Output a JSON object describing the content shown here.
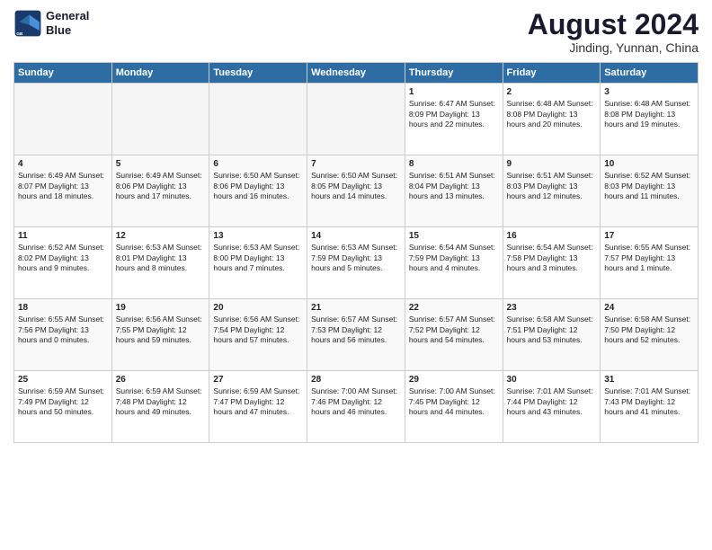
{
  "logo": {
    "line1": "General",
    "line2": "Blue"
  },
  "title": "August 2024",
  "subtitle": "Jinding, Yunnan, China",
  "days_of_week": [
    "Sunday",
    "Monday",
    "Tuesday",
    "Wednesday",
    "Thursday",
    "Friday",
    "Saturday"
  ],
  "weeks": [
    [
      {
        "day": "",
        "info": ""
      },
      {
        "day": "",
        "info": ""
      },
      {
        "day": "",
        "info": ""
      },
      {
        "day": "",
        "info": ""
      },
      {
        "day": "1",
        "info": "Sunrise: 6:47 AM\nSunset: 8:09 PM\nDaylight: 13 hours and 22 minutes."
      },
      {
        "day": "2",
        "info": "Sunrise: 6:48 AM\nSunset: 8:08 PM\nDaylight: 13 hours and 20 minutes."
      },
      {
        "day": "3",
        "info": "Sunrise: 6:48 AM\nSunset: 8:08 PM\nDaylight: 13 hours and 19 minutes."
      }
    ],
    [
      {
        "day": "4",
        "info": "Sunrise: 6:49 AM\nSunset: 8:07 PM\nDaylight: 13 hours and 18 minutes."
      },
      {
        "day": "5",
        "info": "Sunrise: 6:49 AM\nSunset: 8:06 PM\nDaylight: 13 hours and 17 minutes."
      },
      {
        "day": "6",
        "info": "Sunrise: 6:50 AM\nSunset: 8:06 PM\nDaylight: 13 hours and 16 minutes."
      },
      {
        "day": "7",
        "info": "Sunrise: 6:50 AM\nSunset: 8:05 PM\nDaylight: 13 hours and 14 minutes."
      },
      {
        "day": "8",
        "info": "Sunrise: 6:51 AM\nSunset: 8:04 PM\nDaylight: 13 hours and 13 minutes."
      },
      {
        "day": "9",
        "info": "Sunrise: 6:51 AM\nSunset: 8:03 PM\nDaylight: 13 hours and 12 minutes."
      },
      {
        "day": "10",
        "info": "Sunrise: 6:52 AM\nSunset: 8:03 PM\nDaylight: 13 hours and 11 minutes."
      }
    ],
    [
      {
        "day": "11",
        "info": "Sunrise: 6:52 AM\nSunset: 8:02 PM\nDaylight: 13 hours and 9 minutes."
      },
      {
        "day": "12",
        "info": "Sunrise: 6:53 AM\nSunset: 8:01 PM\nDaylight: 13 hours and 8 minutes."
      },
      {
        "day": "13",
        "info": "Sunrise: 6:53 AM\nSunset: 8:00 PM\nDaylight: 13 hours and 7 minutes."
      },
      {
        "day": "14",
        "info": "Sunrise: 6:53 AM\nSunset: 7:59 PM\nDaylight: 13 hours and 5 minutes."
      },
      {
        "day": "15",
        "info": "Sunrise: 6:54 AM\nSunset: 7:59 PM\nDaylight: 13 hours and 4 minutes."
      },
      {
        "day": "16",
        "info": "Sunrise: 6:54 AM\nSunset: 7:58 PM\nDaylight: 13 hours and 3 minutes."
      },
      {
        "day": "17",
        "info": "Sunrise: 6:55 AM\nSunset: 7:57 PM\nDaylight: 13 hours and 1 minute."
      }
    ],
    [
      {
        "day": "18",
        "info": "Sunrise: 6:55 AM\nSunset: 7:56 PM\nDaylight: 13 hours and 0 minutes."
      },
      {
        "day": "19",
        "info": "Sunrise: 6:56 AM\nSunset: 7:55 PM\nDaylight: 12 hours and 59 minutes."
      },
      {
        "day": "20",
        "info": "Sunrise: 6:56 AM\nSunset: 7:54 PM\nDaylight: 12 hours and 57 minutes."
      },
      {
        "day": "21",
        "info": "Sunrise: 6:57 AM\nSunset: 7:53 PM\nDaylight: 12 hours and 56 minutes."
      },
      {
        "day": "22",
        "info": "Sunrise: 6:57 AM\nSunset: 7:52 PM\nDaylight: 12 hours and 54 minutes."
      },
      {
        "day": "23",
        "info": "Sunrise: 6:58 AM\nSunset: 7:51 PM\nDaylight: 12 hours and 53 minutes."
      },
      {
        "day": "24",
        "info": "Sunrise: 6:58 AM\nSunset: 7:50 PM\nDaylight: 12 hours and 52 minutes."
      }
    ],
    [
      {
        "day": "25",
        "info": "Sunrise: 6:59 AM\nSunset: 7:49 PM\nDaylight: 12 hours and 50 minutes."
      },
      {
        "day": "26",
        "info": "Sunrise: 6:59 AM\nSunset: 7:48 PM\nDaylight: 12 hours and 49 minutes."
      },
      {
        "day": "27",
        "info": "Sunrise: 6:59 AM\nSunset: 7:47 PM\nDaylight: 12 hours and 47 minutes."
      },
      {
        "day": "28",
        "info": "Sunrise: 7:00 AM\nSunset: 7:46 PM\nDaylight: 12 hours and 46 minutes."
      },
      {
        "day": "29",
        "info": "Sunrise: 7:00 AM\nSunset: 7:45 PM\nDaylight: 12 hours and 44 minutes."
      },
      {
        "day": "30",
        "info": "Sunrise: 7:01 AM\nSunset: 7:44 PM\nDaylight: 12 hours and 43 minutes."
      },
      {
        "day": "31",
        "info": "Sunrise: 7:01 AM\nSunset: 7:43 PM\nDaylight: 12 hours and 41 minutes."
      }
    ]
  ]
}
